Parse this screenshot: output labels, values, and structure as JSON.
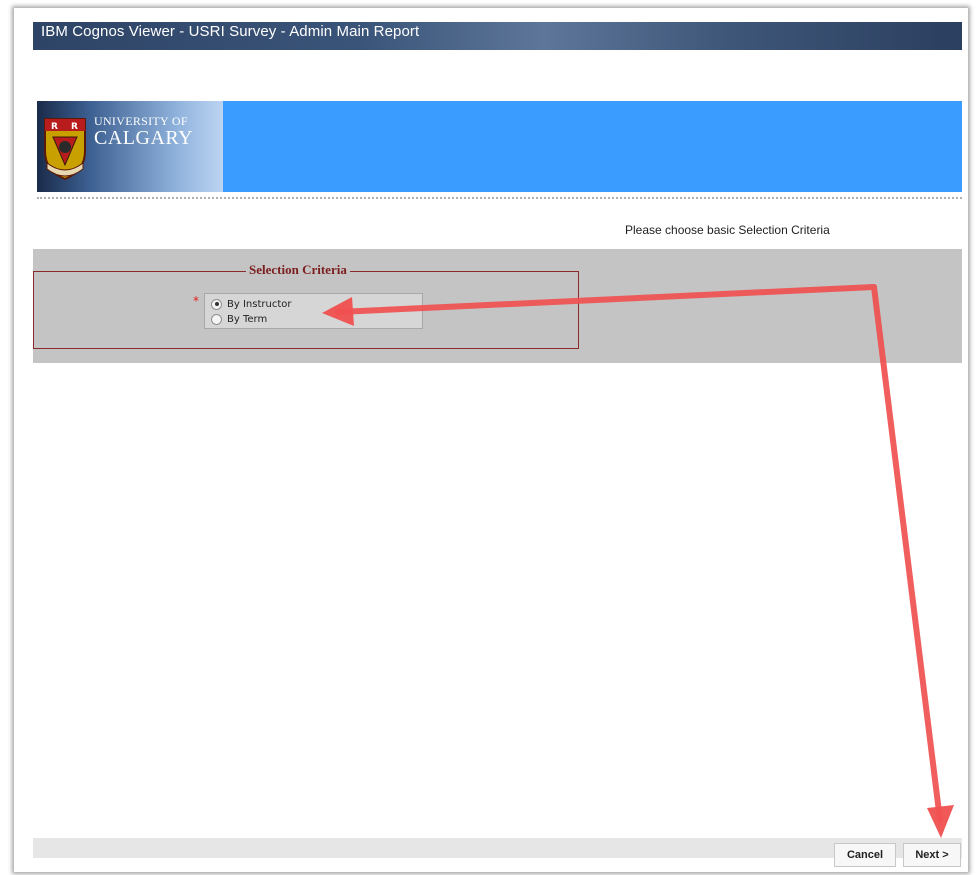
{
  "window": {
    "title": "IBM Cognos Viewer - USRI Survey - Admin Main Report"
  },
  "banner": {
    "logo_line1": "UNIVERSITY OF",
    "logo_line2": "CALGARY",
    "accent_color": "#3b9cff"
  },
  "instruction": "Please choose basic Selection Criteria",
  "selection": {
    "legend": "Selection Criteria",
    "required_marker": "*",
    "options": [
      {
        "label": "By Instructor",
        "selected": true
      },
      {
        "label": "By Term",
        "selected": false
      }
    ]
  },
  "footer": {
    "cancel_label": "Cancel",
    "next_label": "Next >"
  },
  "annotation": {
    "arrow_color": "#f05050"
  }
}
